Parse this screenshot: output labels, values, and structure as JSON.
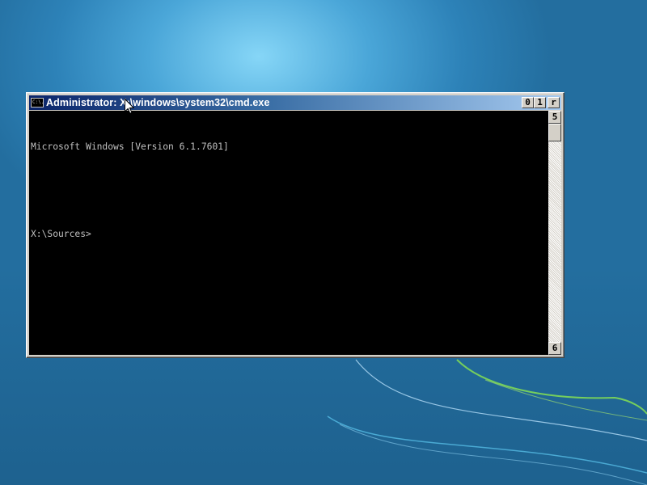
{
  "window": {
    "title": "Administrator: X:\\windows\\system32\\cmd.exe",
    "icon_text": "C:\\.",
    "buttons": {
      "minimize": "0",
      "maximize": "1",
      "close": "r"
    }
  },
  "console": {
    "lines": [
      "Microsoft Windows [Version 6.1.7601]",
      "",
      "X:\\Sources>"
    ]
  },
  "scrollbar": {
    "up_glyph": "5",
    "down_glyph": "6"
  },
  "colors": {
    "console_background": "#000000",
    "console_text": "#c0c0c0",
    "title_bar_start": "#0a246a",
    "title_bar_end": "#a6caf0",
    "desktop": "#2d82b8"
  },
  "icons": {
    "window_icon": "cmd-icon",
    "cursor": "mouse-pointer-icon"
  }
}
